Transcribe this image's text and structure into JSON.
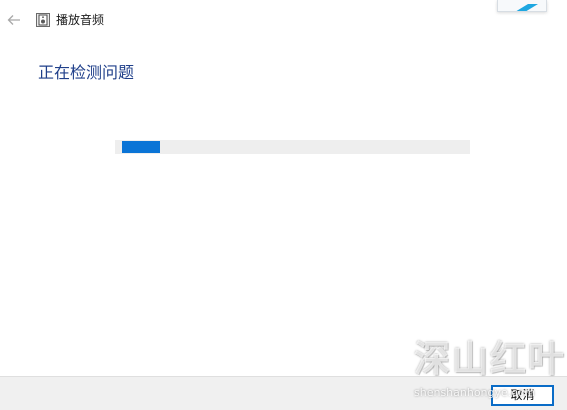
{
  "window": {
    "title": "播放音频"
  },
  "main": {
    "heading": "正在检测问题"
  },
  "progress": {
    "value_fraction": 0.11
  },
  "footer": {
    "cancel_label": "取消"
  },
  "watermark": {
    "text": "深山红叶",
    "url": "shenshanhongye.com"
  },
  "colors": {
    "accent": "#0a74d6",
    "heading": "#1f3f8a",
    "footer_bg": "#f0f0f0",
    "track": "#eeeeee"
  },
  "icons": {
    "back": "back-arrow-icon",
    "app": "speaker-app-icon"
  }
}
